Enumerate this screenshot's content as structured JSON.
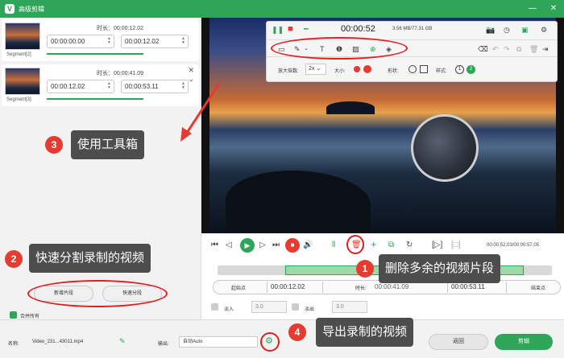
{
  "window": {
    "title": "高级剪辑",
    "logo": "V"
  },
  "segments": [
    {
      "name": "Segment[2]",
      "duration_label": "时长：00:00:12.02",
      "start": "00:00:00.00",
      "end": "00:00:12.02"
    },
    {
      "name": "Segment[3]",
      "duration_label": "时长：00:00:41.09",
      "start": "00:00:12.02",
      "end": "00:00:53.11"
    }
  ],
  "annotations": {
    "a1": {
      "num": "1",
      "text": "删除多余的视频片段"
    },
    "a2": {
      "num": "2",
      "text": "快速分割录制的视频"
    },
    "a3": {
      "num": "3",
      "text": "使用工具箱"
    },
    "a4": {
      "num": "4",
      "text": "导出录制的视频"
    }
  },
  "left_buttons": {
    "new_segment": "新增片段",
    "quick_split": "快速分段"
  },
  "merge_all": "合并所有",
  "toolbox": {
    "record_time": "00:00:52",
    "storage": "3.56 MB/77.31 GB",
    "zoom_label": "放大倍数:",
    "zoom_value": "2x",
    "size_label": "大小:",
    "shape_label": "形状:",
    "style_label": "样式:",
    "style_1": "1",
    "style_2": "2"
  },
  "player": {
    "time": "00:00:52.03/00:00:57.05"
  },
  "trim": {
    "start_label": "起始点",
    "start_value": "00:00:12.02",
    "duration_label": "时长:",
    "duration_value": "00:00:41.09",
    "end_value": "00:00:53.11",
    "end_label": "结束点"
  },
  "fade": {
    "in_label": "淡入",
    "in_value": "3.0",
    "out_label": "淡出",
    "out_value": "3.0"
  },
  "bottom": {
    "name_label": "名称:",
    "file_name": "Video_231...43011.mp4",
    "output_label": "输出:",
    "output_value": "自动Auto",
    "back_button": "返回",
    "edit_button": "剪辑"
  },
  "colors": {
    "brand": "#2fa55a",
    "annotation_red": "#e53b30"
  }
}
